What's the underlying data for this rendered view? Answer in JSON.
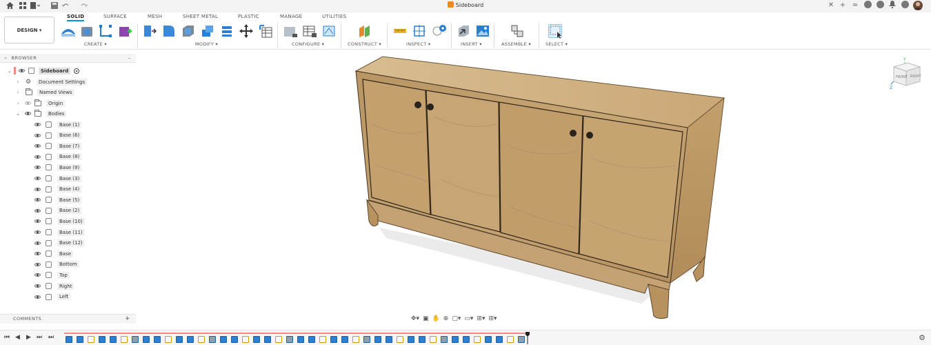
{
  "window": {
    "title": "Sideboard"
  },
  "ribbon": {
    "workspace_label": "DESIGN ▾",
    "tabs": [
      {
        "label": "SOLID",
        "active": true
      },
      {
        "label": "SURFACE",
        "active": false
      },
      {
        "label": "MESH",
        "active": false
      },
      {
        "label": "SHEET METAL",
        "active": false
      },
      {
        "label": "PLASTIC",
        "active": false
      },
      {
        "label": "MANAGE",
        "active": false
      },
      {
        "label": "UTILITIES",
        "active": false
      }
    ],
    "groups": [
      {
        "label": "CREATE ▾"
      },
      {
        "label": "MODIFY ▾"
      },
      {
        "label": "CONFIGURE ▾"
      },
      {
        "label": "CONSTRUCT ▾"
      },
      {
        "label": "INSPECT ▾"
      },
      {
        "label": "INSERT ▾"
      },
      {
        "label": "ASSEMBLE ▾"
      },
      {
        "label": "SELECT ▾"
      }
    ]
  },
  "browser": {
    "title": "BROWSER",
    "root": "Sideboard",
    "items": [
      {
        "label": "Document Settings"
      },
      {
        "label": "Named Views"
      },
      {
        "label": "Origin"
      },
      {
        "label": "Bodies"
      }
    ],
    "bodies": [
      "Base (1)",
      "Base (6)",
      "Base (7)",
      "Base (8)",
      "Base (9)",
      "Base (3)",
      "Base (4)",
      "Base (5)",
      "Base (2)",
      "Base (10)",
      "Base (11)",
      "Base (12)",
      "Base",
      "Bottom",
      "Top",
      "Right",
      "Left"
    ]
  },
  "comments": {
    "label": "COMMENTS"
  },
  "viewcube": {
    "front": "FRONT",
    "right": "RIGHT"
  },
  "colors": {
    "accent": "#0696d7",
    "wood": "#c9a877",
    "timeline_red": "#f28b82"
  }
}
